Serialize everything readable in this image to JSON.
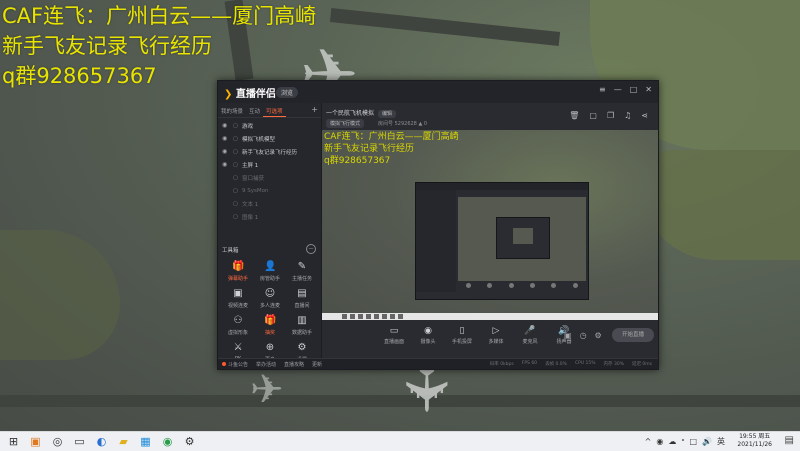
{
  "overlay": {
    "line1": "CAF连飞：广州白云——厦门高崎",
    "line2": "新手飞友记录飞行经历",
    "line3": "q群928657367"
  },
  "app": {
    "name": "直播伴侣",
    "version_pill": "浏览",
    "window_controls": [
      "≡",
      "—",
      "□",
      "✕"
    ],
    "left_tabs": [
      {
        "label": "我的场景",
        "active": false
      },
      {
        "label": "互动",
        "active": false
      },
      {
        "label": "可选项",
        "active": true
      }
    ],
    "add_tab": "+",
    "scenes": [
      {
        "label": "游戏",
        "dim": false
      },
      {
        "label": "模拟飞机模型",
        "dim": false
      },
      {
        "label": "新手飞友记录飞行经历",
        "dim": false
      },
      {
        "label": "主屏 1",
        "dim": false
      },
      {
        "label": "窗口捕获",
        "dim": true
      },
      {
        "label": "9 SysMon",
        "dim": true
      },
      {
        "label": "文本 1",
        "dim": true
      },
      {
        "label": "图像 1",
        "dim": true
      }
    ],
    "tools_title": "工具箱",
    "tools_toggle": "—",
    "tools": [
      {
        "label": "弹幕助手",
        "icon": "gift-icon",
        "glyph": "🎁",
        "highlight": true
      },
      {
        "label": "房管助手",
        "icon": "user-icon",
        "glyph": "👤",
        "highlight": false
      },
      {
        "label": "主播任务",
        "icon": "task-icon",
        "glyph": "✎",
        "highlight": false
      },
      {
        "label": "视频连麦",
        "icon": "video-icon",
        "glyph": "▣",
        "highlight": false
      },
      {
        "label": "多人连麦",
        "icon": "group-icon",
        "glyph": "☺",
        "highlight": false
      },
      {
        "label": "直播间",
        "icon": "room-icon",
        "glyph": "▤",
        "highlight": false
      },
      {
        "label": "虚拟形象",
        "icon": "avatar-icon",
        "glyph": "⚇",
        "highlight": false
      },
      {
        "label": "抽奖",
        "icon": "lottery-icon",
        "glyph": "🎁",
        "highlight": true
      },
      {
        "label": "数据助手",
        "icon": "data-icon",
        "glyph": "▥",
        "highlight": false
      },
      {
        "label": "PK",
        "icon": "pk-icon",
        "glyph": "⚔",
        "highlight": false
      },
      {
        "label": "更多",
        "icon": "more-icon",
        "glyph": "⊕",
        "highlight": false
      },
      {
        "label": "设置",
        "icon": "settings-icon",
        "glyph": "⚙",
        "highlight": false
      }
    ],
    "bottom_links": [
      "斗鱼公告",
      "举办活动",
      "直播攻略",
      "更新"
    ],
    "live": {
      "title": "一个民航飞机模拟",
      "title_pill": "编辑",
      "category_pill": "模拟飞行模式",
      "info": "房间号 5292628",
      "likes": "0"
    },
    "preview_overlay": {
      "line1": "CAF连飞：广州白云——厦门高崎",
      "line2": "新手飞友记录飞行经历",
      "line3": "q群928657367"
    },
    "controls": [
      {
        "label": "直播画面",
        "icon": "screen-icon",
        "glyph": "▭",
        "red": false
      },
      {
        "label": "摄像头",
        "icon": "camera-icon",
        "glyph": "◉",
        "red": false
      },
      {
        "label": "手机投屏",
        "icon": "phone-icon",
        "glyph": "▯",
        "red": false
      },
      {
        "label": "多媒体",
        "icon": "media-icon",
        "glyph": "▷",
        "red": false
      },
      {
        "label": "麦克风",
        "icon": "mic-icon",
        "glyph": "🎤",
        "red": true
      },
      {
        "label": "扬声器",
        "icon": "speaker-icon",
        "glyph": "🔊",
        "red": false
      }
    ],
    "go_live": "开始直播",
    "stats": [
      "码率 0kbps",
      "FPS 60",
      "丢帧 0.0%",
      "CPU 15%",
      "内存 30%",
      "延迟 0ms"
    ]
  },
  "taskbar": {
    "icons": [
      {
        "name": "start-icon",
        "glyph": "⊞"
      },
      {
        "name": "app-icon",
        "glyph": "▣"
      },
      {
        "name": "steam-icon",
        "glyph": "◎"
      },
      {
        "name": "window-icon",
        "glyph": "▭"
      },
      {
        "name": "browser-icon",
        "glyph": "◐"
      },
      {
        "name": "folder-icon",
        "glyph": "▰"
      },
      {
        "name": "store-icon",
        "glyph": "▦"
      },
      {
        "name": "chrome-icon",
        "glyph": "◉"
      },
      {
        "name": "gear-icon",
        "glyph": "⚙"
      }
    ],
    "tray": [
      "^",
      "◉",
      "☁",
      "ᐤ",
      "□",
      "🔊",
      "英"
    ],
    "time": "19:55 周五",
    "date": "2021/11/26"
  }
}
